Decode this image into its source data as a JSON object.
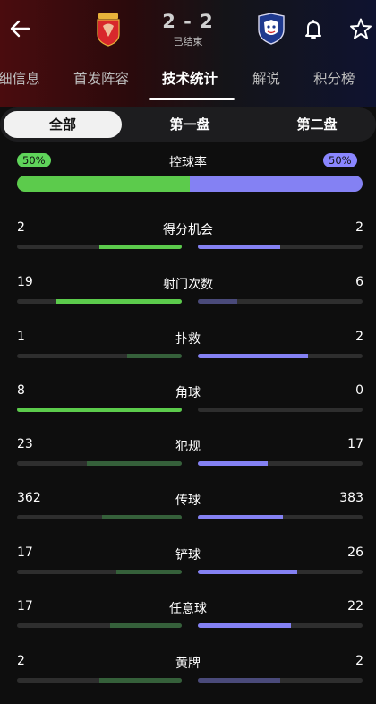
{
  "header": {
    "score": "2 - 2",
    "status": "已结束",
    "icons": [
      "back-arrow-icon",
      "home-team-logo",
      "away-team-logo",
      "bell-icon",
      "star-icon"
    ]
  },
  "tabs": [
    {
      "label": "细信息"
    },
    {
      "label": "首发阵容"
    },
    {
      "label": "技术统计",
      "active": true
    },
    {
      "label": "解说"
    },
    {
      "label": "积分榜"
    }
  ],
  "segments": [
    {
      "label": "全部",
      "active": true
    },
    {
      "label": "第一盘"
    },
    {
      "label": "第二盘"
    }
  ],
  "possession": {
    "label": "控球率",
    "home_text": "50%",
    "away_text": "50%",
    "home_fraction": 0.5,
    "away_fraction": 0.5
  },
  "stats": [
    {
      "label": "得分机会",
      "home": "2",
      "away": "2",
      "home_frac": 0.5,
      "away_frac": 0.5,
      "home_strong": true,
      "away_strong": true
    },
    {
      "label": "射门次数",
      "home": "19",
      "away": "6",
      "home_frac": 0.76,
      "away_frac": 0.24,
      "home_strong": true,
      "away_strong": false
    },
    {
      "label": "扑救",
      "home": "1",
      "away": "2",
      "home_frac": 0.33,
      "away_frac": 0.67,
      "home_strong": false,
      "away_strong": true
    },
    {
      "label": "角球",
      "home": "8",
      "away": "0",
      "home_frac": 1.0,
      "away_frac": 0.0,
      "home_strong": true,
      "away_strong": false
    },
    {
      "label": "犯规",
      "home": "23",
      "away": "17",
      "home_frac": 0.575,
      "away_frac": 0.425,
      "home_strong": false,
      "away_strong": true
    },
    {
      "label": "传球",
      "home": "362",
      "away": "383",
      "home_frac": 0.486,
      "away_frac": 0.514,
      "home_strong": false,
      "away_strong": true
    },
    {
      "label": "铲球",
      "home": "17",
      "away": "26",
      "home_frac": 0.395,
      "away_frac": 0.605,
      "home_strong": false,
      "away_strong": true
    },
    {
      "label": "任意球",
      "home": "17",
      "away": "22",
      "home_frac": 0.436,
      "away_frac": 0.564,
      "home_strong": false,
      "away_strong": true
    },
    {
      "label": "黄牌",
      "home": "2",
      "away": "2",
      "home_frac": 0.5,
      "away_frac": 0.5,
      "home_strong": false,
      "away_strong": false
    }
  ],
  "colors": {
    "home_strong": "#5ccb4c",
    "home_weak": "#35603a",
    "away_strong": "#8481f3",
    "away_weak": "#4a4a7a"
  }
}
